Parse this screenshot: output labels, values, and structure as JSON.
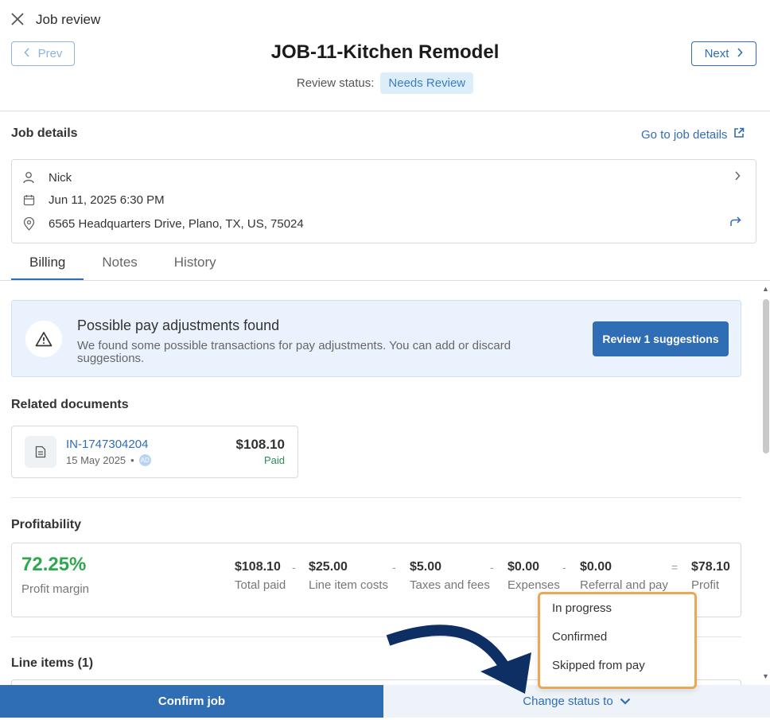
{
  "header": {
    "title": "Job review",
    "prev_label": "Prev",
    "next_label": "Next",
    "job_title": "JOB-11-Kitchen Remodel",
    "review_status_label": "Review status:",
    "review_status_value": "Needs Review"
  },
  "job_details": {
    "heading": "Job details",
    "goto_link": "Go to job details",
    "customer": "Nick",
    "datetime": "Jun 11, 2025 6:30 PM",
    "address": "6565 Headquarters Drive, Plano, TX, US, 75024"
  },
  "tabs": [
    {
      "label": "Billing",
      "active": true
    },
    {
      "label": "Notes",
      "active": false
    },
    {
      "label": "History",
      "active": false
    }
  ],
  "alert": {
    "title": "Possible pay adjustments found",
    "text": "We found some possible transactions for pay adjustments. You can add or discard suggestions.",
    "button": "Review 1 suggestions"
  },
  "related_documents": {
    "heading": "Related documents",
    "doc": {
      "name": "IN-1747304204",
      "date": "15 May 2025",
      "bullet": "•",
      "avatar": "AD",
      "amount": "$108.10",
      "status": "Paid"
    }
  },
  "profitability": {
    "heading": "Profitability",
    "margin_value": "72.25%",
    "margin_label": "Profit margin",
    "metrics": [
      {
        "value": "$108.10",
        "label": "Total paid"
      },
      {
        "value": "$25.00",
        "label": "Line item costs"
      },
      {
        "value": "$5.00",
        "label": "Taxes and fees"
      },
      {
        "value": "$0.00",
        "label": "Expenses"
      },
      {
        "value": "$0.00",
        "label": "Referral and pay"
      },
      {
        "value": "$78.10",
        "label": "Profit"
      }
    ],
    "operators": [
      "-",
      "-",
      "-",
      "-",
      "="
    ]
  },
  "line_items": {
    "heading": "Line items (1)"
  },
  "footer": {
    "confirm": "Confirm job",
    "change_status": "Change status to"
  },
  "status_dropdown": {
    "options": [
      "In progress",
      "Confirmed",
      "Skipped from pay"
    ]
  },
  "colors": {
    "accent": "#2f6db5",
    "success": "#2ea84f",
    "highlight": "#e8a857",
    "annotation_arrow": "#0e2f63"
  }
}
